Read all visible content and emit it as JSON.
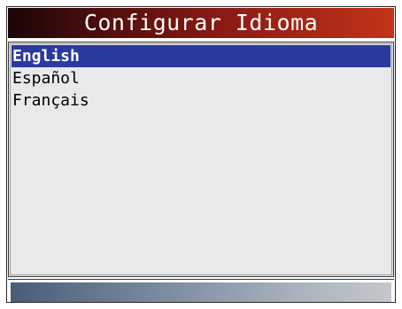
{
  "screen": {
    "title": "Configurar Idioma"
  },
  "language_menu": {
    "selected_index": 0,
    "items": [
      {
        "label": "English"
      },
      {
        "label": "Español"
      },
      {
        "label": "Français"
      }
    ]
  },
  "colors": {
    "title_bar_dark": "#1a0505",
    "title_bar_red": "#c23318",
    "selection_highlight": "#2b3a9e",
    "list_background": "#e8e9eb",
    "bottom_bar_left": "#4a5d78",
    "bottom_bar_right": "#c4c8cc"
  }
}
